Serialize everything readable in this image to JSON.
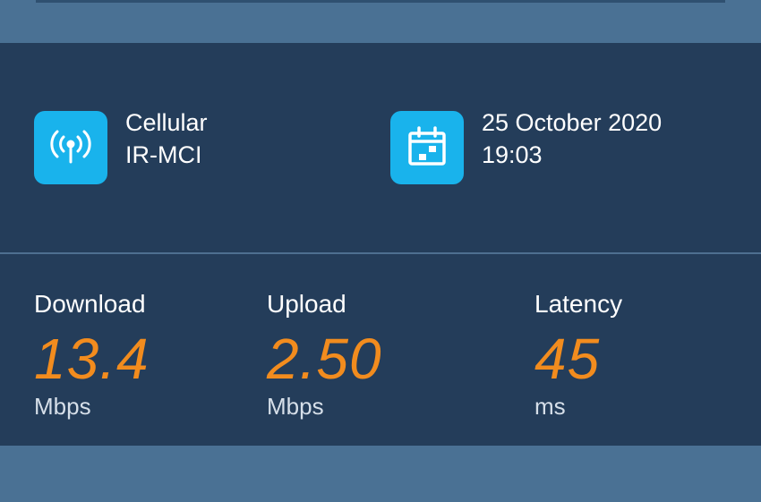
{
  "connection": {
    "type": "Cellular",
    "carrier": "IR-MCI"
  },
  "test_time": {
    "date": "25 October 2020",
    "time": "19:03"
  },
  "metrics": {
    "download": {
      "label": "Download",
      "value": "13.4",
      "unit": "Mbps"
    },
    "upload": {
      "label": "Upload",
      "value": "2.50",
      "unit": "Mbps"
    },
    "latency": {
      "label": "Latency",
      "value": "45",
      "unit": "ms"
    }
  },
  "colors": {
    "accent": "#f28c1e",
    "icon_tile": "#19b3ec",
    "card_bg": "#243d5a",
    "frame_bg": "#4a7194"
  },
  "icons": {
    "connection": "cellular-signal-icon",
    "date": "calendar-icon"
  }
}
